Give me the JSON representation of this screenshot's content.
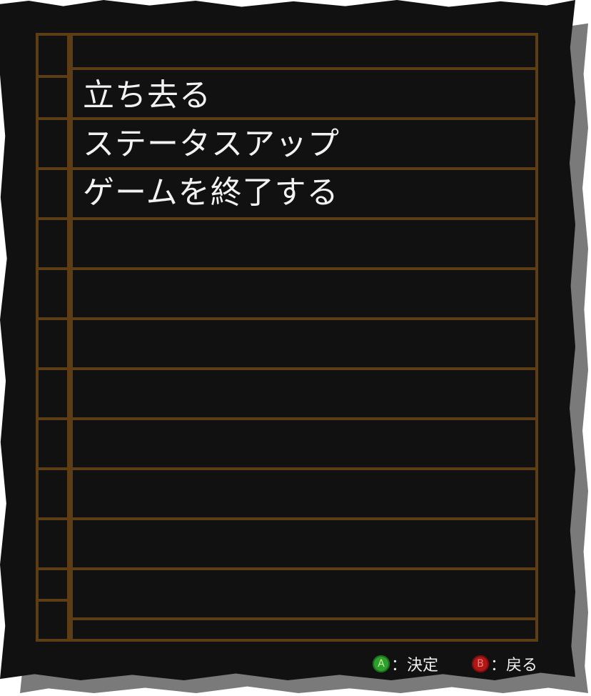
{
  "menu": {
    "items": [
      {
        "label": "立ち去る"
      },
      {
        "label": "ステータスアップ"
      },
      {
        "label": "ゲームを終了する"
      }
    ]
  },
  "footer": {
    "confirm": {
      "button": "A",
      "label": "：決定",
      "color": "#2ea02e"
    },
    "back": {
      "button": "B",
      "label": "：戻る",
      "color": "#b01818"
    }
  },
  "colors": {
    "panel": "#111111",
    "lines": "#5c3d14",
    "shadow": "#7a7a7a",
    "text": "#f2f2f2"
  }
}
